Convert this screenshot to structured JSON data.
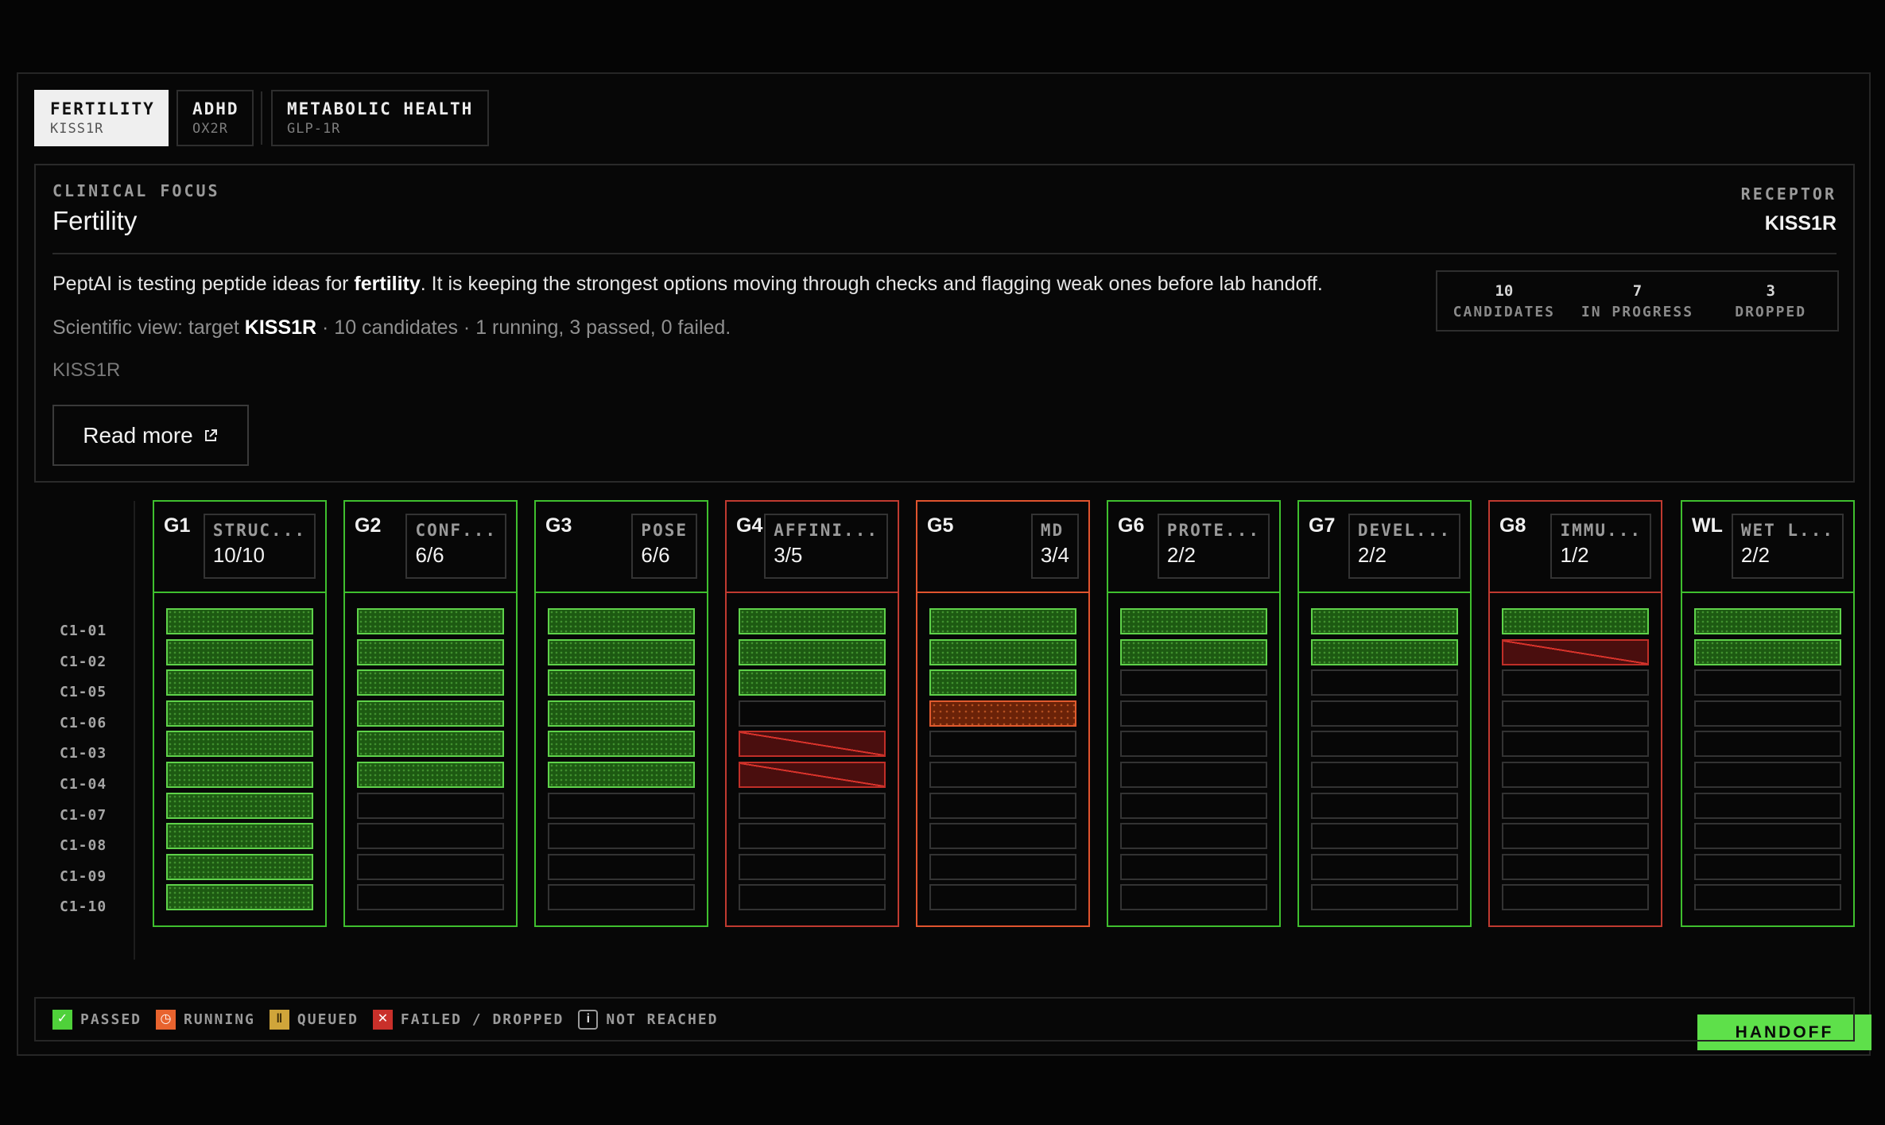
{
  "tabs": [
    {
      "label": "FERTILITY",
      "sub": "KISS1R",
      "active": true
    },
    {
      "label": "ADHD",
      "sub": "OX2R",
      "active": false
    },
    {
      "label": "METABOLIC HEALTH",
      "sub": "GLP-1R",
      "active": false
    }
  ],
  "focus": {
    "label": "CLINICAL FOCUS",
    "title": "Fertility",
    "receptor_label": "RECEPTOR",
    "receptor_value": "KISS1R",
    "description_pre": "PeptAI is testing peptide ideas for ",
    "description_bold": "fertility",
    "description_post": ". It is keeping the strongest options moving through checks and flagging weak ones before lab handoff.",
    "scientific_pre": "Scientific view: target ",
    "scientific_bold": "KISS1R",
    "scientific_post": " · 10 candidates · 1 running, 3 passed, 0 failed.",
    "target_line": "KISS1R",
    "read_more": "Read more"
  },
  "stats": [
    {
      "value": "10",
      "label": "CANDIDATES"
    },
    {
      "value": "7",
      "label": "IN PROGRESS"
    },
    {
      "value": "3",
      "label": "DROPPED"
    }
  ],
  "rows": [
    "C1-01",
    "C1-02",
    "C1-05",
    "C1-06",
    "C1-03",
    "C1-04",
    "C1-07",
    "C1-08",
    "C1-09",
    "C1-10"
  ],
  "gates": [
    {
      "id": "G1",
      "name": "STRUC...",
      "count": "10/10",
      "status": "passed",
      "cells": [
        "passed",
        "passed",
        "passed",
        "passed",
        "passed",
        "passed",
        "passed",
        "passed",
        "passed",
        "passed"
      ]
    },
    {
      "id": "G2",
      "name": "CONF...",
      "count": "6/6",
      "status": "passed",
      "cells": [
        "passed",
        "passed",
        "passed",
        "passed",
        "passed",
        "passed",
        "empty",
        "empty",
        "empty",
        "empty"
      ]
    },
    {
      "id": "G3",
      "name": "POSE",
      "count": "6/6",
      "status": "passed",
      "cells": [
        "passed",
        "passed",
        "passed",
        "passed",
        "passed",
        "passed",
        "empty",
        "empty",
        "empty",
        "empty"
      ]
    },
    {
      "id": "G4",
      "name": "AFFINI...",
      "count": "3/5",
      "status": "failed",
      "cells": [
        "passed",
        "passed",
        "passed",
        "empty",
        "failed",
        "failed",
        "empty",
        "empty",
        "empty",
        "empty"
      ]
    },
    {
      "id": "G5",
      "name": "MD",
      "count": "3/4",
      "status": "running",
      "cells": [
        "passed",
        "passed",
        "passed",
        "running",
        "empty",
        "empty",
        "empty",
        "empty",
        "empty",
        "empty"
      ]
    },
    {
      "id": "G6",
      "name": "PROTE...",
      "count": "2/2",
      "status": "passed",
      "cells": [
        "passed",
        "passed",
        "empty",
        "empty",
        "empty",
        "empty",
        "empty",
        "empty",
        "empty",
        "empty"
      ]
    },
    {
      "id": "G7",
      "name": "DEVEL...",
      "count": "2/2",
      "status": "passed",
      "cells": [
        "passed",
        "passed",
        "empty",
        "empty",
        "empty",
        "empty",
        "empty",
        "empty",
        "empty",
        "empty"
      ]
    },
    {
      "id": "G8",
      "name": "IMMU...",
      "count": "1/2",
      "status": "failed",
      "cells": [
        "passed",
        "failed",
        "empty",
        "empty",
        "empty",
        "empty",
        "empty",
        "empty",
        "empty",
        "empty"
      ]
    },
    {
      "id": "WL",
      "name": "WET L...",
      "count": "2/2",
      "status": "passed",
      "cells": [
        "passed",
        "passed",
        "empty",
        "empty",
        "empty",
        "empty",
        "empty",
        "empty",
        "empty",
        "empty"
      ]
    }
  ],
  "handoff_label": "HANDOFF",
  "legend": [
    {
      "key": "passed",
      "label": "PASSED",
      "icon": "check-icon",
      "glyph": "✓",
      "color": "#4fd13a"
    },
    {
      "key": "running",
      "label": "RUNNING",
      "icon": "clock-icon",
      "glyph": "◷",
      "color": "#e8632e"
    },
    {
      "key": "queued",
      "label": "QUEUED",
      "icon": "pause-icon",
      "glyph": "ǁ",
      "color": "#d0a53a"
    },
    {
      "key": "failed",
      "label": "FAILED / DROPPED",
      "icon": "cross-icon",
      "glyph": "✕",
      "color": "#c9302a"
    },
    {
      "key": "not-reached",
      "label": "NOT REACHED",
      "icon": "info-icon",
      "glyph": "i",
      "color": "#9a9a9a"
    }
  ],
  "colors": {
    "passed": "#4fd13a",
    "running": "#e8632e",
    "failed": "#c9302a",
    "accent": "#5ee04a"
  }
}
